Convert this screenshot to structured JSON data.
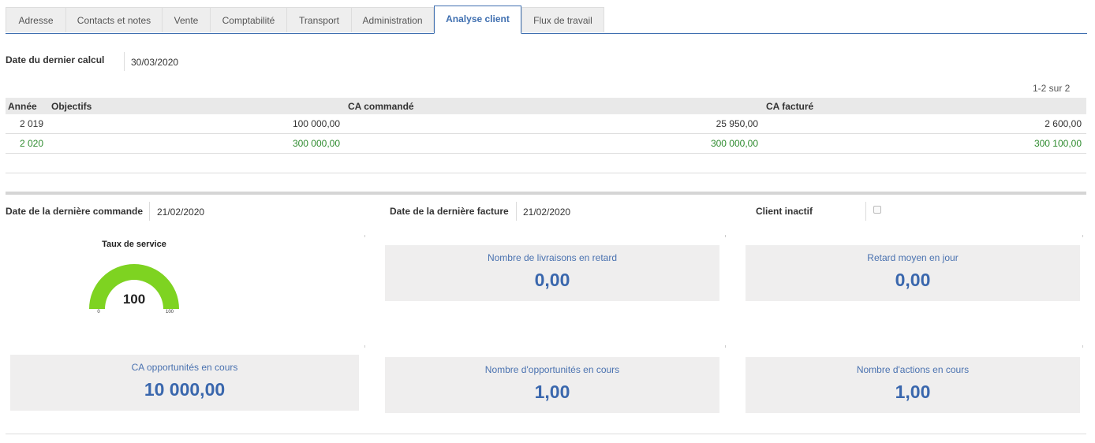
{
  "tabs": [
    {
      "label": "Adresse",
      "active": false
    },
    {
      "label": "Contacts et notes",
      "active": false
    },
    {
      "label": "Vente",
      "active": false
    },
    {
      "label": "Comptabilité",
      "active": false
    },
    {
      "label": "Transport",
      "active": false
    },
    {
      "label": "Administration",
      "active": false
    },
    {
      "label": "Analyse client",
      "active": true
    },
    {
      "label": "Flux de travail",
      "active": false
    }
  ],
  "last_calc": {
    "label": "Date du dernier calcul",
    "value": "30/03/2020"
  },
  "table": {
    "pager": "1-2 sur 2",
    "columns": [
      "Année",
      "Objectifs",
      "CA commandé",
      "CA facturé"
    ],
    "rows": [
      {
        "annee": "2 019",
        "objectifs": "100 000,00",
        "ca_commande": "25 950,00",
        "ca_facture": "2 600,00",
        "highlight": false
      },
      {
        "annee": "2 020",
        "objectifs": "300 000,00",
        "ca_commande": "300 000,00",
        "ca_facture": "300 100,00",
        "highlight": true
      }
    ]
  },
  "last_order": {
    "label": "Date de la dernière commande",
    "value": "21/02/2020"
  },
  "last_invoice": {
    "label": "Date de la dernière facture",
    "value": "21/02/2020"
  },
  "inactive": {
    "label": "Client inactif",
    "checked": false
  },
  "gauge": {
    "title": "Taux de service",
    "value": 100,
    "value_text": "100",
    "min": "0",
    "max": "100",
    "color": "#7ed321",
    "track_color": "#e6e6e6"
  },
  "kpis": [
    {
      "label": "Nombre de livraisons en retard",
      "value": "0,00"
    },
    {
      "label": "Retard moyen en jour",
      "value": "0,00"
    },
    {
      "label": "CA opportunités en cours",
      "value": "10 000,00"
    },
    {
      "label": "Nombre d'opportunités en cours",
      "value": "1,00"
    },
    {
      "label": "Nombre d'actions en cours",
      "value": "1,00"
    }
  ],
  "colors": {
    "accent": "#3f6fb0",
    "positive_row": "#2e8b2e",
    "kpi_bg": "#efeeee",
    "kpi_text": "#3a67ad"
  }
}
